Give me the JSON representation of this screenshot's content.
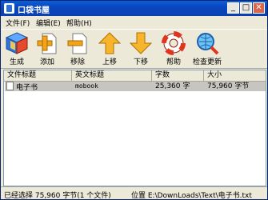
{
  "window": {
    "title": "口袋书屋"
  },
  "menu": [
    "文件(F)",
    "编辑(E)",
    "帮助(H)"
  ],
  "toolbar": [
    {
      "label": "生成",
      "icon": "stack-cube-icon"
    },
    {
      "label": "添加",
      "icon": "add-file-icon"
    },
    {
      "label": "移除",
      "icon": "remove-file-icon"
    },
    {
      "label": "上移",
      "icon": "arrow-up-icon"
    },
    {
      "label": "下移",
      "icon": "arrow-down-icon"
    },
    {
      "label": "帮助",
      "icon": "lifebuoy-icon"
    },
    {
      "label": "检查更新",
      "icon": "magnifier-globe-icon"
    }
  ],
  "table": {
    "columns": [
      "文件标题",
      "英文标题",
      "字数",
      "大小"
    ],
    "rows": [
      {
        "title": "电子书",
        "english": "mobook",
        "words": "25,360 字",
        "size": "75,960 字节"
      }
    ]
  },
  "status": {
    "selection": "已经选择 75,960 字节(1 个文件)",
    "location": "位置 E:\\DownLoads\\Text\\电子书.txt"
  }
}
